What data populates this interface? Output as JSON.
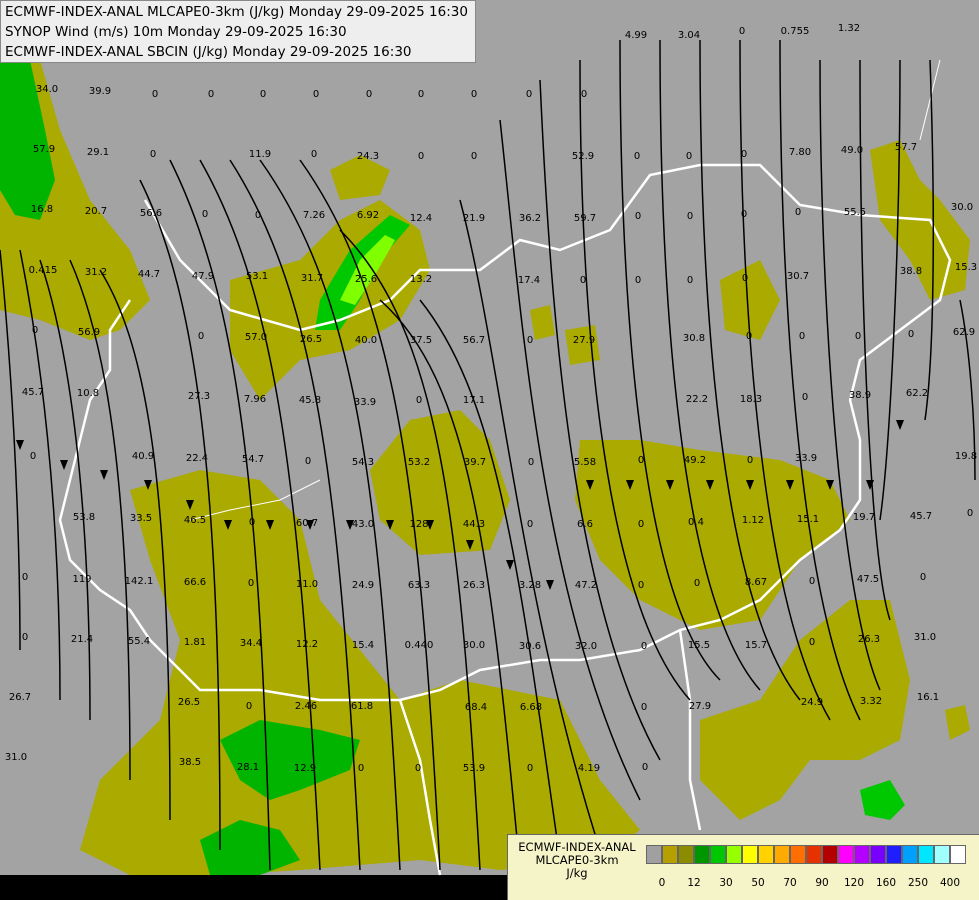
{
  "header": {
    "line1": "ECMWF-INDEX-ANAL MLCAPE0-3km (J/kg) Monday 29-09-2025 16:30",
    "line2": "SYNOP Wind (m/s) 10m Monday 29-09-2025 16:30",
    "line3": "ECMWF-INDEX-ANAL SBCIN (J/kg) Monday 29-09-2025 16:30"
  },
  "legend": {
    "title_line1": "ECMWF-INDEX-ANAL",
    "title_line2": "MLCAPE0-3km",
    "title_line3": "J/kg",
    "colors": [
      "#a0a0a0",
      "#b5a000",
      "#8c8c00",
      "#009600",
      "#00c800",
      "#96ff00",
      "#ffff00",
      "#ffd200",
      "#ffaa00",
      "#ff6e00",
      "#e63200",
      "#b40000",
      "#ff00ff",
      "#b400ff",
      "#7800ff",
      "#1e1eff",
      "#00a0ff",
      "#00e6ff",
      "#a0ffff",
      "#ffffff"
    ],
    "ticks": [
      "0",
      "12",
      "30",
      "50",
      "70",
      "90",
      "120",
      "160",
      "250",
      "400"
    ]
  },
  "colors": {
    "background": "#a3a3a3",
    "cape_low": "#aaaa00",
    "cape_mid": "#00b400",
    "cape_high": "#80ff00",
    "borders": "#ffffff",
    "streamlines": "#000000"
  },
  "map_labels": [
    "34.0",
    "39.9",
    "0",
    "0",
    "0",
    "0",
    "0",
    "0",
    "0",
    "0",
    "0",
    "4.99",
    "3.04",
    "0",
    "0.755",
    "1.32",
    "57.9",
    "29.1",
    "0",
    "11.9",
    "0",
    "24.3",
    "0",
    "0",
    "52.9",
    "0",
    "0",
    "0",
    "7.80",
    "49.0",
    "57.7",
    "16.8",
    "20.7",
    "56.6",
    "0",
    "0",
    "7.26",
    "6.92",
    "12.4",
    "21.9",
    "36.2",
    "59.7",
    "0",
    "0",
    "0",
    "0",
    "55.5",
    "30.0",
    "0.415",
    "31.2",
    "44.7",
    "47.9",
    "53.1",
    "31.7",
    "25.6",
    "13.2",
    "17.4",
    "0",
    "0",
    "0",
    "0",
    "30.7",
    "38.8",
    "15.3",
    "0",
    "56.9",
    "0",
    "57.0",
    "26.5",
    "40.0",
    "37.5",
    "56.7",
    "0",
    "27.9",
    "30.8",
    "0",
    "0",
    "0",
    "0",
    "62.9",
    "45.7",
    "10.8",
    "27.3",
    "7.96",
    "45.8",
    "33.9",
    "0",
    "17.1",
    "22.2",
    "18.3",
    "0",
    "38.9",
    "62.2",
    "0",
    "40.9",
    "22.4",
    "54.7",
    "0",
    "54.3",
    "53.2",
    "39.7",
    "0",
    "5.58",
    "0",
    "49.2",
    "0",
    "33.9",
    "19.8",
    "53.8",
    "33.5",
    "46.5",
    "0",
    "60.7",
    "43.0",
    "128",
    "44.3",
    "0",
    "6.6",
    "0",
    "0.4",
    "1.12",
    "15.1",
    "19.7",
    "45.7",
    "0",
    "0",
    "119",
    "142.1",
    "66.6",
    "0",
    "11.0",
    "24.9",
    "63.3",
    "26.3",
    "3.28",
    "47.2",
    "0",
    "0",
    "8.67",
    "0",
    "47.5",
    "0",
    "0",
    "21.4",
    "55.4",
    "1.81",
    "34.4",
    "12.2",
    "15.4",
    "0.440",
    "30.0",
    "30.6",
    "32.0",
    "0",
    "15.5",
    "15.7",
    "0",
    "26.3",
    "31.0",
    "26.7",
    "26.5",
    "0",
    "2.46",
    "61.8",
    "68.4",
    "6.68",
    "0",
    "27.9",
    "24.9",
    "3.32",
    "16.1",
    "31.0",
    "38.5",
    "28.1",
    "12.9",
    "0",
    "0",
    "53.9",
    "0",
    "4.19",
    "0"
  ]
}
